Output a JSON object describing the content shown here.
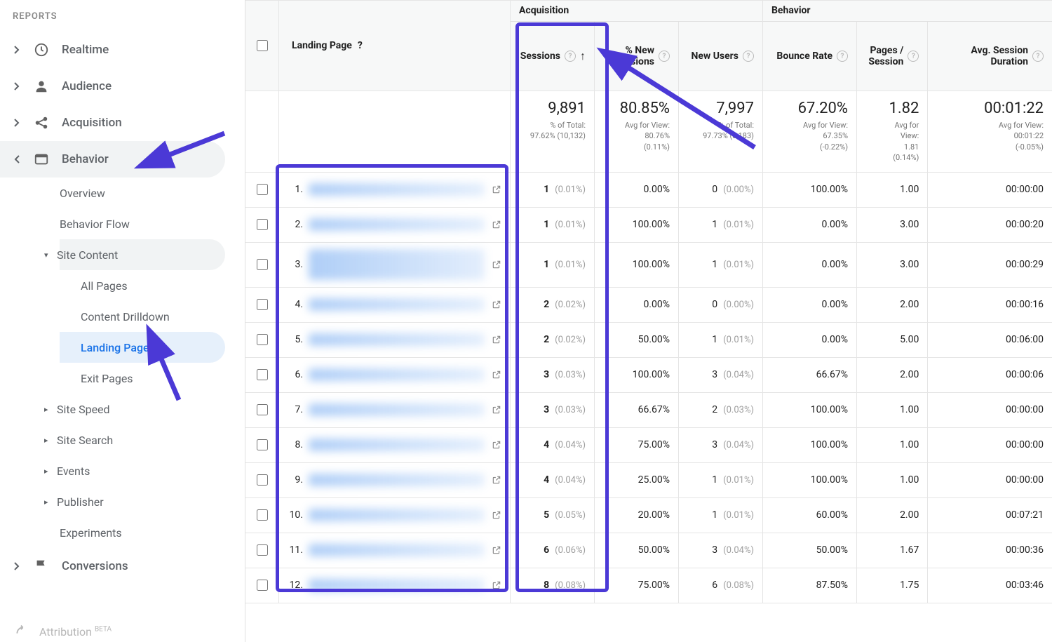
{
  "sidebar": {
    "section_label": "REPORTS",
    "realtime": "Realtime",
    "audience": "Audience",
    "acquisition": "Acquisition",
    "behavior": "Behavior",
    "behavior_children": {
      "overview": "Overview",
      "behavior_flow": "Behavior Flow",
      "site_content": "Site Content",
      "site_content_children": {
        "all_pages": "All Pages",
        "content_drilldown": "Content Drilldown",
        "landing_pages": "Landing Pages",
        "exit_pages": "Exit Pages"
      },
      "site_speed": "Site Speed",
      "site_search": "Site Search",
      "events": "Events",
      "publisher": "Publisher",
      "experiments": "Experiments"
    },
    "conversions": "Conversions",
    "attribution": "Attribution",
    "beta": "BETA"
  },
  "headers": {
    "landing_page": "Landing Page",
    "acquisition": "Acquisition",
    "behavior": "Behavior",
    "sessions": "Sessions",
    "pct_new_sessions": "% New Sessions",
    "new_users": "New Users",
    "bounce_rate": "Bounce Rate",
    "pages_session": "Pages / Session",
    "avg_session_duration": "Avg. Session Duration"
  },
  "summary": {
    "sessions": {
      "big": "9,891",
      "sub1": "% of Total:",
      "sub2": "97.62% (10,132)"
    },
    "pct_new": {
      "big": "80.85%",
      "sub1": "Avg for View:",
      "sub2": "80.76%",
      "sub3": "(0.11%)"
    },
    "new_users": {
      "big": "7,997",
      "sub1": "% of Total:",
      "sub2": "97.73% (8,183)"
    },
    "bounce": {
      "big": "67.20%",
      "sub1": "Avg for View:",
      "sub2": "67.35%",
      "sub3": "(-0.22%)"
    },
    "pages": {
      "big": "1.82",
      "sub1": "Avg for",
      "sub2": "View:",
      "sub3": "1.81",
      "sub4": "(0.14%)"
    },
    "duration": {
      "big": "00:01:22",
      "sub1": "Avg for View:",
      "sub2": "00:01:22",
      "sub3": "(-0.05%)"
    }
  },
  "rows": [
    {
      "idx": "1.",
      "sessions": "1",
      "sessions_pct": "(0.01%)",
      "pct_new": "0.00%",
      "new_users": "0",
      "new_users_pct": "(0.00%)",
      "bounce": "100.00%",
      "pages": "1.00",
      "dur": "00:00:00"
    },
    {
      "idx": "2.",
      "sessions": "1",
      "sessions_pct": "(0.01%)",
      "pct_new": "100.00%",
      "new_users": "1",
      "new_users_pct": "(0.01%)",
      "bounce": "0.00%",
      "pages": "3.00",
      "dur": "00:00:20"
    },
    {
      "idx": "3.",
      "sessions": "1",
      "sessions_pct": "(0.01%)",
      "pct_new": "100.00%",
      "new_users": "1",
      "new_users_pct": "(0.01%)",
      "bounce": "0.00%",
      "pages": "3.00",
      "dur": "00:00:29",
      "tall": true
    },
    {
      "idx": "4.",
      "sessions": "2",
      "sessions_pct": "(0.02%)",
      "pct_new": "0.00%",
      "new_users": "0",
      "new_users_pct": "(0.00%)",
      "bounce": "0.00%",
      "pages": "2.00",
      "dur": "00:00:16"
    },
    {
      "idx": "5.",
      "sessions": "2",
      "sessions_pct": "(0.02%)",
      "pct_new": "50.00%",
      "new_users": "1",
      "new_users_pct": "(0.01%)",
      "bounce": "0.00%",
      "pages": "5.00",
      "dur": "00:06:00"
    },
    {
      "idx": "6.",
      "sessions": "3",
      "sessions_pct": "(0.03%)",
      "pct_new": "100.00%",
      "new_users": "3",
      "new_users_pct": "(0.04%)",
      "bounce": "66.67%",
      "pages": "2.00",
      "dur": "00:00:06"
    },
    {
      "idx": "7.",
      "sessions": "3",
      "sessions_pct": "(0.03%)",
      "pct_new": "66.67%",
      "new_users": "2",
      "new_users_pct": "(0.03%)",
      "bounce": "100.00%",
      "pages": "1.00",
      "dur": "00:00:00"
    },
    {
      "idx": "8.",
      "sessions": "4",
      "sessions_pct": "(0.04%)",
      "pct_new": "75.00%",
      "new_users": "3",
      "new_users_pct": "(0.04%)",
      "bounce": "100.00%",
      "pages": "1.00",
      "dur": "00:00:00"
    },
    {
      "idx": "9.",
      "sessions": "4",
      "sessions_pct": "(0.04%)",
      "pct_new": "25.00%",
      "new_users": "1",
      "new_users_pct": "(0.01%)",
      "bounce": "100.00%",
      "pages": "1.00",
      "dur": "00:00:00"
    },
    {
      "idx": "10.",
      "sessions": "5",
      "sessions_pct": "(0.05%)",
      "pct_new": "20.00%",
      "new_users": "1",
      "new_users_pct": "(0.01%)",
      "bounce": "60.00%",
      "pages": "2.00",
      "dur": "00:07:21"
    },
    {
      "idx": "11.",
      "sessions": "6",
      "sessions_pct": "(0.06%)",
      "pct_new": "50.00%",
      "new_users": "3",
      "new_users_pct": "(0.04%)",
      "bounce": "50.00%",
      "pages": "1.67",
      "dur": "00:00:36"
    },
    {
      "idx": "12.",
      "sessions": "8",
      "sessions_pct": "(0.08%)",
      "pct_new": "75.00%",
      "new_users": "6",
      "new_users_pct": "(0.08%)",
      "bounce": "87.50%",
      "pages": "1.75",
      "dur": "00:03:46"
    }
  ]
}
